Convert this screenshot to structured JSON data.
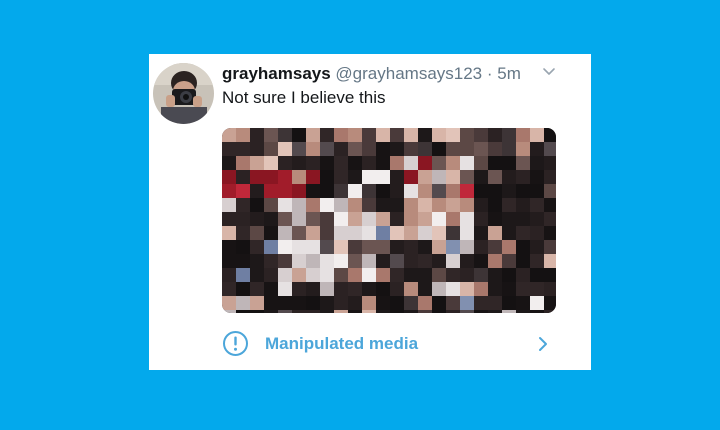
{
  "tweet": {
    "display_name": "grayhamsays",
    "handle": "@grayhamsays123",
    "separator": "·",
    "timestamp": "5m",
    "text": "Not sure I believe this"
  },
  "notice": {
    "label": "Manipulated media"
  },
  "icons": {
    "avatar": "avatar-photo",
    "menu": "chevron-down-icon",
    "notice": "info-icon",
    "notice_arrow": "chevron-right-icon"
  },
  "colors": {
    "background": "#03a9ec",
    "card": "#ffffff",
    "notice_accent": "#4ca6da",
    "text_primary": "#14171a",
    "text_secondary": "#657786"
  }
}
